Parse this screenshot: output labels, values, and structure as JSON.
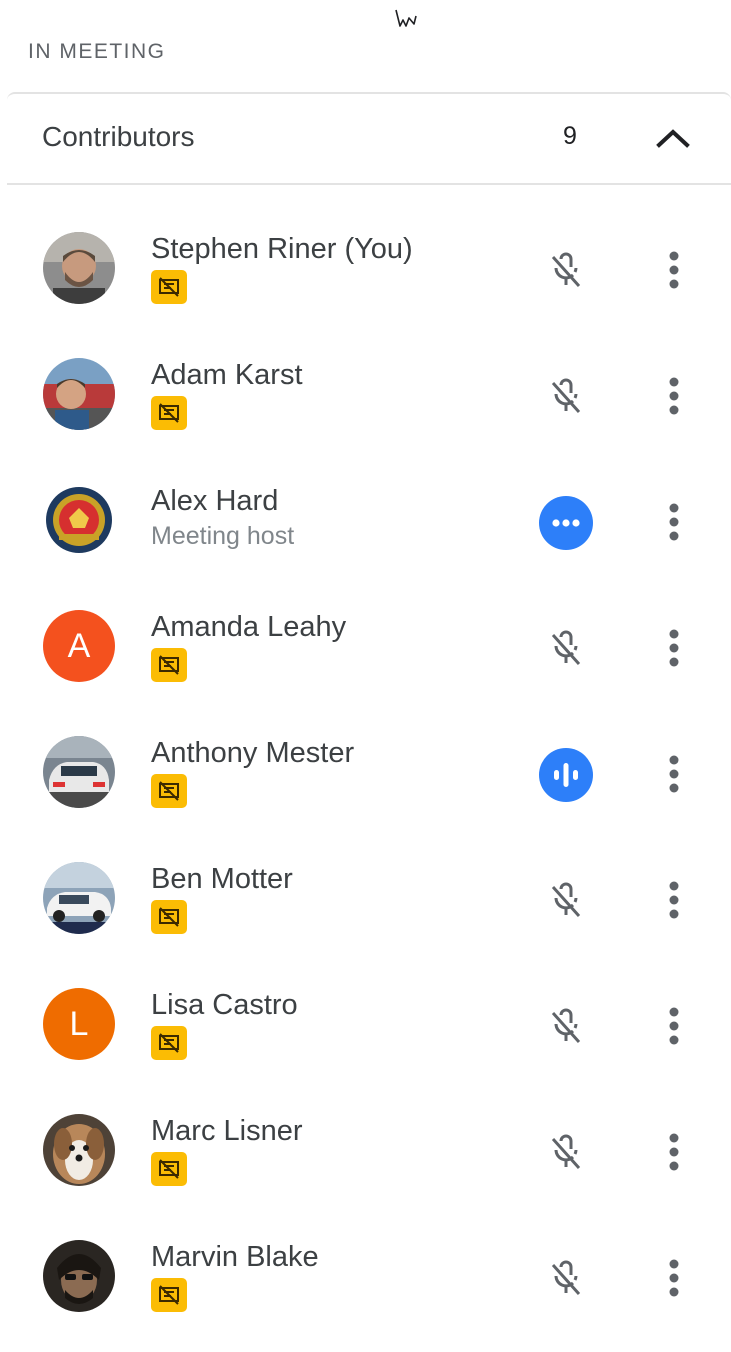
{
  "section": {
    "title": "IN MEETING"
  },
  "group": {
    "title": "Contributors",
    "count": "9"
  },
  "icons": {
    "badge": "presentation-off-icon",
    "mic": "mic-off-icon",
    "more": "more-vert-icon",
    "collapse": "chevron-up-icon"
  },
  "colors": {
    "badge": "#fbbc04",
    "speaking": "#2d7ff9",
    "avatar_a": "#f4511e",
    "avatar_l": "#ef6c00"
  },
  "participants": [
    {
      "name": "Stephen Riner (You)",
      "status": "muted"
    },
    {
      "name": "Adam Karst",
      "status": "muted"
    },
    {
      "name": "Alex Hard",
      "role": "Meeting host",
      "status": "dots"
    },
    {
      "name": "Amanda Leahy",
      "initial": "A",
      "status": "muted"
    },
    {
      "name": "Anthony Mester",
      "status": "speaking"
    },
    {
      "name": "Ben Motter",
      "status": "muted"
    },
    {
      "name": "Lisa Castro",
      "initial": "L",
      "status": "muted"
    },
    {
      "name": "Marc Lisner",
      "status": "muted"
    },
    {
      "name": "Marvin Blake",
      "status": "muted"
    }
  ]
}
